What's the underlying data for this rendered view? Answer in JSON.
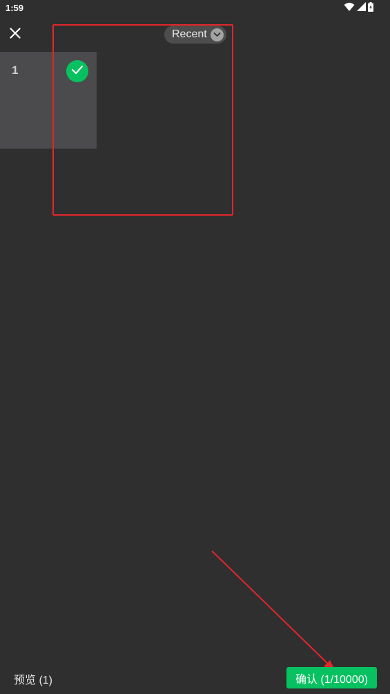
{
  "status_bar": {
    "time": "1:59",
    "icons": [
      "wifi-icon",
      "cellular-signal-icon",
      "battery-icon"
    ]
  },
  "header": {
    "close_icon": "close-icon",
    "album_selector": {
      "label": "Recent",
      "icon": "chevron-down-icon"
    }
  },
  "grid": {
    "items": [
      {
        "number": "1",
        "selected": true,
        "icon": "checkmark-icon"
      }
    ]
  },
  "footer": {
    "preview_label": "预览 (1)",
    "confirm_label": "确认 (1/10000)"
  },
  "colors": {
    "background": "#2f2f2f",
    "accent_green": "#07c160",
    "annotation_red": "#e3262b",
    "tile": "#4b4a4c",
    "pill": "#4d4d4d"
  }
}
